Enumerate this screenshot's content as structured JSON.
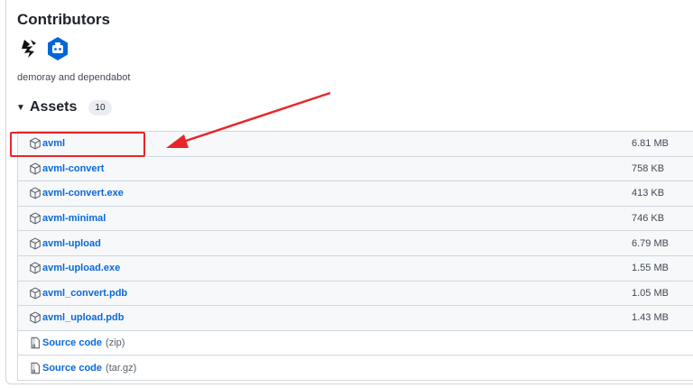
{
  "contributors": {
    "title": "Contributors",
    "names": "demoray and dependabot",
    "avatars": [
      {
        "icon": "demoray-avatar-icon"
      },
      {
        "icon": "dependabot-avatar-icon"
      }
    ]
  },
  "assets": {
    "title": "Assets",
    "count": "10",
    "items": [
      {
        "name": "avml",
        "size": "6.81 MB",
        "icon": "package-icon"
      },
      {
        "name": "avml-convert",
        "size": "758 KB",
        "icon": "package-icon"
      },
      {
        "name": "avml-convert.exe",
        "size": "413 KB",
        "icon": "package-icon"
      },
      {
        "name": "avml-minimal",
        "size": "746 KB",
        "icon": "package-icon"
      },
      {
        "name": "avml-upload",
        "size": "6.79 MB",
        "icon": "package-icon"
      },
      {
        "name": "avml-upload.exe",
        "size": "1.55 MB",
        "icon": "package-icon"
      },
      {
        "name": "avml_convert.pdb",
        "size": "1.05 MB",
        "icon": "package-icon"
      },
      {
        "name": "avml_upload.pdb",
        "size": "1.43 MB",
        "icon": "package-icon"
      }
    ],
    "source": [
      {
        "name": "Source code",
        "ext": "(zip)",
        "icon": "file-zip-icon"
      },
      {
        "name": "Source code",
        "ext": "(tar.gz)",
        "icon": "file-zip-icon"
      }
    ]
  },
  "colors": {
    "link": "#0969da",
    "annotation": "#e8262a"
  }
}
